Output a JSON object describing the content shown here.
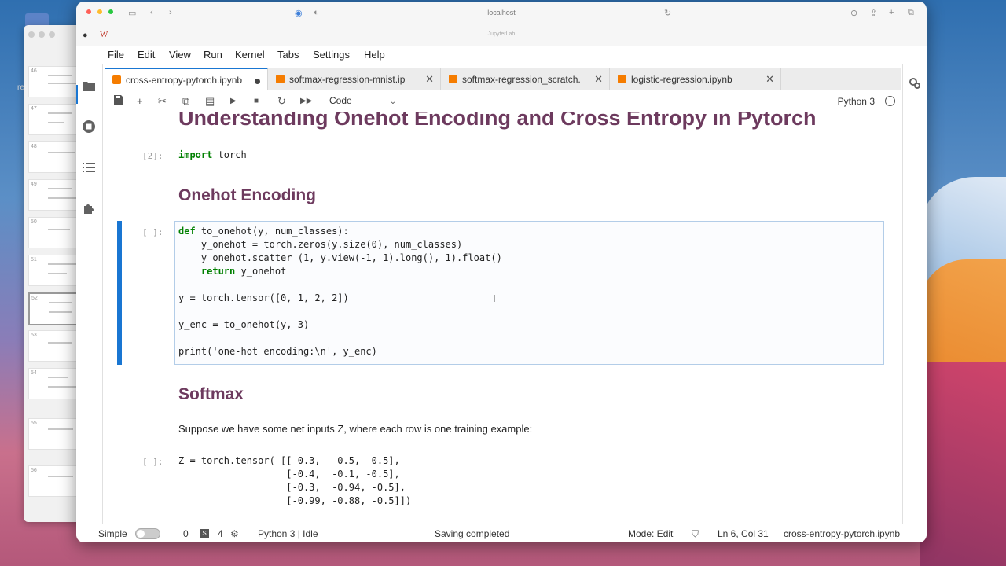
{
  "browser": {
    "url": "localhost",
    "subtitle": "JupyterLab"
  },
  "desktop": {
    "label": "res"
  },
  "background_window": {
    "thumbnail_numbers": [
      "46",
      "47",
      "48",
      "49",
      "50",
      "51",
      "52",
      "53",
      "54",
      "55",
      "56"
    ]
  },
  "menu": {
    "items": [
      "File",
      "Edit",
      "View",
      "Run",
      "Kernel",
      "Tabs",
      "Settings",
      "Help"
    ]
  },
  "tabs": [
    {
      "label": "cross-entropy-pytorch.ipynb",
      "active": true,
      "modified": true
    },
    {
      "label": "softmax-regression-mnist.ip",
      "active": false,
      "modified": false
    },
    {
      "label": "softmax-regression_scratch.",
      "active": false,
      "modified": false
    },
    {
      "label": "logistic-regression.ipynb",
      "active": false,
      "modified": false
    }
  ],
  "toolbar": {
    "cell_type": "Code",
    "kernel": "Python 3"
  },
  "notebook": {
    "title": "Understanding Onehot Encoding and Cross Entropy in Pytorch",
    "cell1": {
      "prompt": "[2]:",
      "code_kw": "import",
      "code_rest": " torch"
    },
    "heading_onehot": "Onehot Encoding",
    "cell2": {
      "prompt": "[ ]:",
      "lines": [
        "def to_onehot(y, num_classes):",
        "    y_onehot = torch.zeros(y.size(0), num_classes)",
        "    y_onehot.scatter_(1, y.view(-1, 1).long(), 1).float()",
        "    return y_onehot",
        "",
        "y = torch.tensor([0, 1, 2, 2])",
        "",
        "y_enc = to_onehot(y, 3)",
        "",
        "print('one-hot encoding:\\n', y_enc)"
      ]
    },
    "heading_softmax": "Softmax",
    "markdown": "Suppose we have some net inputs Z, where each row is one training example:",
    "cell3": {
      "prompt": "[ ]:",
      "lines": [
        "Z = torch.tensor( [[-0.3,  -0.5, -0.5],",
        "                   [-0.4,  -0.1, -0.5],",
        "                   [-0.3,  -0.94, -0.5],",
        "                   [-0.99, -0.88, -0.5]])"
      ]
    }
  },
  "status": {
    "mode_label": "Simple",
    "count1": "0",
    "badge": "S",
    "count2": "4",
    "kernel_status": "Python 3 | Idle",
    "message": "Saving completed",
    "edit_mode": "Mode: Edit",
    "position": "Ln 6, Col 31",
    "filename": "cross-entropy-pytorch.ipynb"
  },
  "colors": {
    "accent": "#1976d2",
    "heading": "#6d3a5e",
    "notebook_icon": "#f57c00"
  }
}
